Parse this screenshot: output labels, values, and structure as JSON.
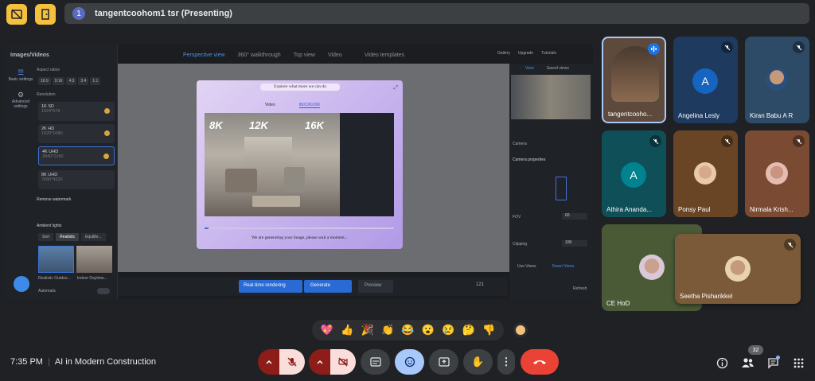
{
  "presenting": {
    "badge": "1",
    "text": "tangentcoohom1 tsr (Presenting)"
  },
  "shared_screen": {
    "panel_title": "Images/Videos",
    "nav": [
      "Basic settings",
      "Advanced settings"
    ],
    "aspect_label": "Aspect ratios",
    "ratios": [
      "16:9",
      "9:16",
      "4:3",
      "3:4",
      "1:1"
    ],
    "resolution_label": "Resolution",
    "cards": [
      {
        "title": "1K SD",
        "sub": "1024*576"
      },
      {
        "title": "2K HD",
        "sub": "1920*1080"
      },
      {
        "title": "4K UHD",
        "sub": "3840*2160"
      },
      {
        "title": "8K UHD",
        "sub": "7680*4320"
      }
    ],
    "remove_watermark": "Remove watermark",
    "ambient_lights": "Ambient lights",
    "light_tabs": [
      "Sort",
      "Realistic",
      "Equilibr..."
    ],
    "light_captions": [
      "Realistic Outdoo...",
      "Indoor Daytime..."
    ],
    "automatic": "Automatic",
    "view_tabs": [
      "Perspective view",
      "360° walkthrough",
      "Top view",
      "Video"
    ],
    "video_templates": "Video templates",
    "right_tools": [
      "Gallery",
      "Upgrade",
      "Tutorials"
    ],
    "right_tabs": [
      "View",
      "Saved views"
    ],
    "camera_header": "Camera",
    "camera_props": "Camera properties",
    "fov_label": "FOV",
    "fov_value": "60",
    "clipping_label": "Clipping",
    "clipping_value": "100",
    "bottom_tabs": [
      "Use Views",
      "Smart Views"
    ],
    "refresh": "Refresh",
    "realtime_label": "Real-time rendering",
    "generate_label": "Generate",
    "preview_label": "Preview",
    "zoom_value": "121"
  },
  "modal": {
    "title": "Explore what more we can do",
    "tabs": [
      "Video",
      "8K/12K/16K"
    ],
    "resolutions": [
      "8K",
      "12K",
      "16K"
    ],
    "progress_fraction": 0.02,
    "message": "We are generating your image, please wait a moment..."
  },
  "participants": [
    {
      "name": "tangentcoohom1 tsr",
      "display": "tangentcooho...",
      "speaking": true
    },
    {
      "name": "Angelina Lesly",
      "display": "Angelina Lesly",
      "initial": "A",
      "color": "#1565c0"
    },
    {
      "name": "Kiran Babu A R",
      "display": "Kiran Babu A R"
    },
    {
      "name": "Athira Ananda",
      "display": "Athira Ananda...",
      "initial": "A",
      "color": "#00838f"
    },
    {
      "name": "Ponsy Paul",
      "display": "Ponsy Paul"
    },
    {
      "name": "Nirmala Krish",
      "display": "Nirmala Krish..."
    },
    {
      "name": "CE HoD",
      "display": "CE HoD"
    },
    {
      "name": "Seetha Pisharikkel",
      "display": "Seetha Pisharikkel"
    }
  ],
  "reactions": [
    "💖",
    "👍",
    "🎉",
    "👏",
    "😂",
    "😮",
    "😢",
    "🤔",
    "👎"
  ],
  "meeting": {
    "time": "7:35 PM",
    "title": "AI in Modern Construction",
    "participant_count": "32"
  },
  "colors": {
    "mic_off": "#f9dedc",
    "end_call": "#ea4335",
    "reactions_active": "#a8c7fa",
    "accent": "#f6c03f"
  }
}
